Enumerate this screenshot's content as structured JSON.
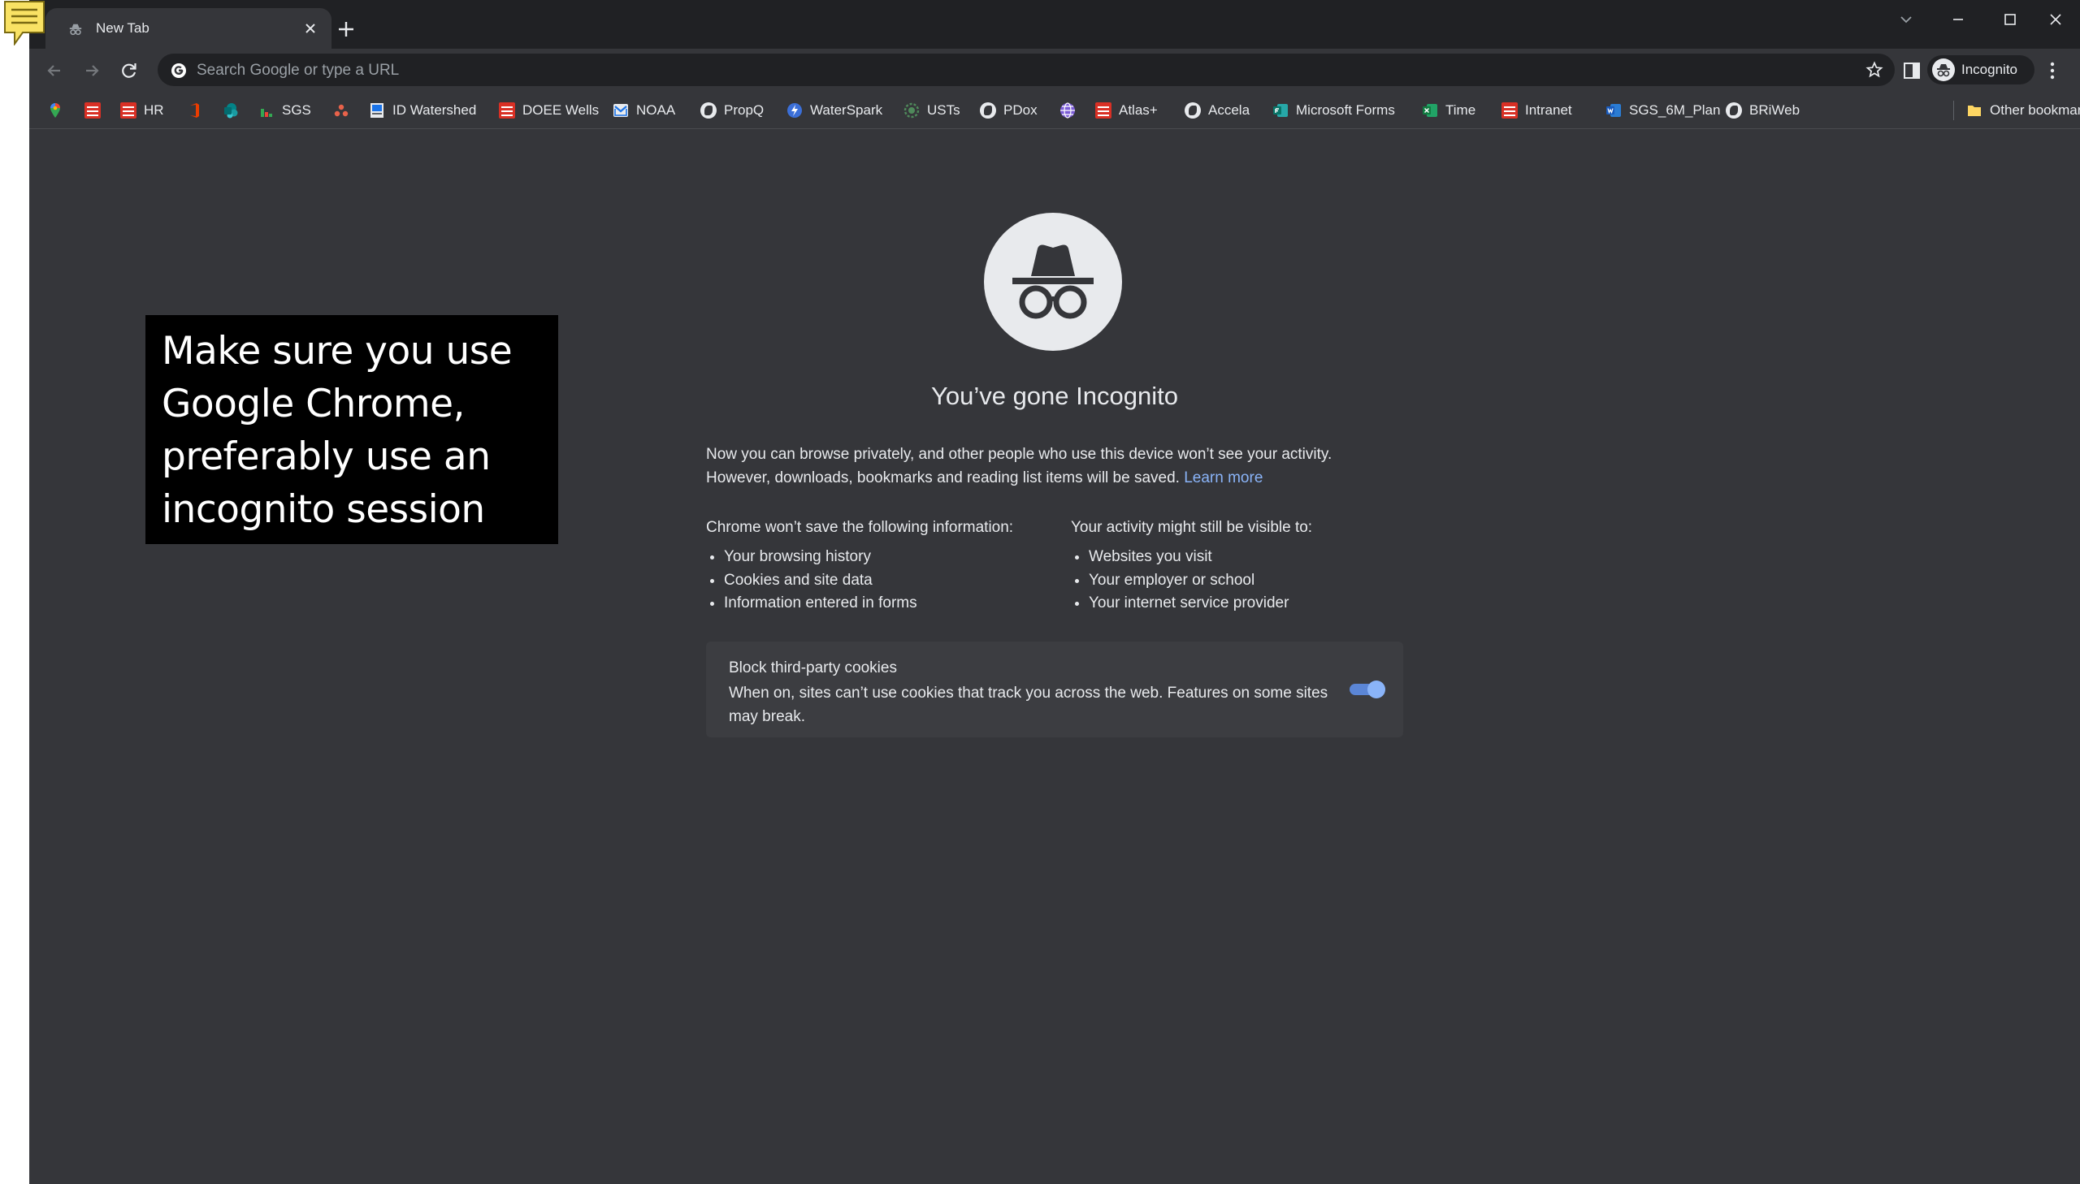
{
  "tab": {
    "title": "New Tab"
  },
  "omnibox": {
    "placeholder": "Search Google or type a URL"
  },
  "profile": {
    "label": "Incognito"
  },
  "bookmarks": {
    "items": [
      {
        "label": "",
        "icon": "maps-pin-icon"
      },
      {
        "label": "",
        "icon": "red-sheet-icon"
      },
      {
        "label": "HR",
        "icon": "red-sheet-icon"
      },
      {
        "label": "",
        "icon": "office-icon"
      },
      {
        "label": "",
        "icon": "sharepoint-icon"
      },
      {
        "label": "SGS",
        "icon": "bars-icon"
      },
      {
        "label": "",
        "icon": "people-icon"
      },
      {
        "label": "ID Watershed",
        "icon": "doc-icon"
      },
      {
        "label": "DOEE Wells",
        "icon": "red-sheet-icon"
      },
      {
        "label": "NOAA",
        "icon": "outlook-icon"
      },
      {
        "label": "PropQ",
        "icon": "globe-icon"
      },
      {
        "label": "WaterSpark",
        "icon": "waterspark-icon"
      },
      {
        "label": "USTs",
        "icon": "gear-globe-icon"
      },
      {
        "label": "PDox",
        "icon": "globe-icon"
      },
      {
        "label": "",
        "icon": "purple-globe-icon"
      },
      {
        "label": "Atlas+",
        "icon": "red-sheet-icon"
      },
      {
        "label": "Accela",
        "icon": "globe-icon"
      },
      {
        "label": "Microsoft Forms",
        "icon": "forms-icon"
      },
      {
        "label": "Time",
        "icon": "excel-icon"
      },
      {
        "label": "Intranet",
        "icon": "red-sheet-icon"
      },
      {
        "label": "SGS_6M_Plan",
        "icon": "word-icon"
      },
      {
        "label": "BRiWeb",
        "icon": "globe-icon"
      }
    ],
    "other": "Other bookmarks"
  },
  "incognito": {
    "title": "You’ve gone Incognito",
    "intro_line1": "Now you can browse privately, and other people who use this device won’t see your activity.",
    "intro_line2": "However, downloads, bookmarks and reading list items will be saved.",
    "learn_more": "Learn more",
    "not_saved": {
      "heading_prefix": "Chrome ",
      "heading_bold": "won’t save",
      "heading_suffix": " the following information:",
      "items": [
        "Your browsing history",
        "Cookies and site data",
        "Information entered in forms"
      ]
    },
    "visible_to": {
      "heading_prefix": "Your activity ",
      "heading_bold": "might still be visible",
      "heading_suffix": " to:",
      "items": [
        "Websites you visit",
        "Your employer or school",
        "Your internet service provider"
      ]
    },
    "cookies_card": {
      "title": "Block third-party cookies",
      "description": "When on, sites can’t use cookies that track you across the web. Features on some sites may break.",
      "toggle_on": true
    }
  },
  "callout": {
    "text": "Make sure you use Google Chrome, preferably use an incognito session"
  },
  "colors": {
    "page_bg": "#35363a",
    "tabstrip_bg": "#202124",
    "text": "#e8eaed",
    "link": "#8ab4f8",
    "toggle_on": "#8ab4f8"
  }
}
